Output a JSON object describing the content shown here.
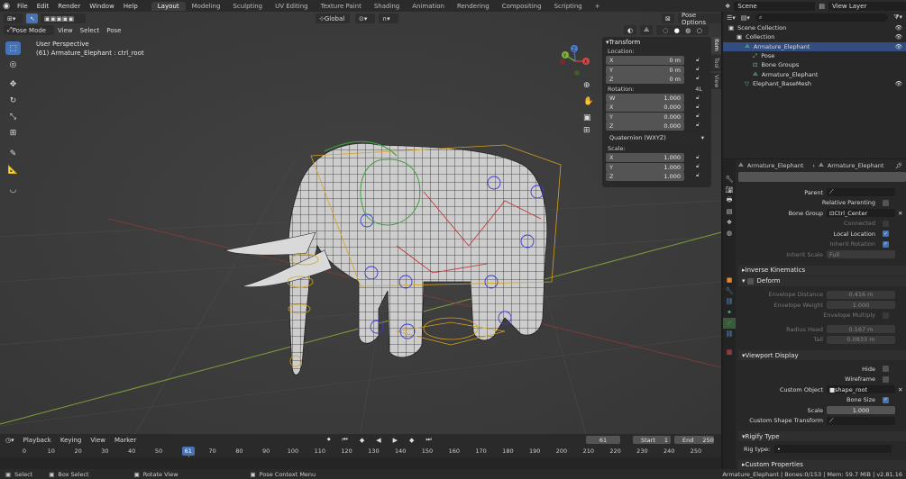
{
  "topbar": {
    "menus": [
      "File",
      "Edit",
      "Render",
      "Window",
      "Help"
    ],
    "workspaces": [
      "Layout",
      "Modeling",
      "Sculpting",
      "UV Editing",
      "Texture Paint",
      "Shading",
      "Animation",
      "Rendering",
      "Compositing",
      "Scripting"
    ],
    "active_workspace": "Layout",
    "add_workspace": "+",
    "scene": "Scene",
    "view_layer": "View Layer"
  },
  "viewport": {
    "mode": "Pose Mode",
    "menus": [
      "View",
      "Select",
      "Pose"
    ],
    "orientation": "Global",
    "pose_options": "Pose Options",
    "info_line1": "User Perspective",
    "info_line2": "(61) Armature_Elephant : ctrl_root",
    "gizmo": {
      "x": "X",
      "y": "Y",
      "z": "Z"
    }
  },
  "npanel": {
    "title": "Transform",
    "location_label": "Location:",
    "location": [
      {
        "k": "X",
        "v": "0 m"
      },
      {
        "k": "Y",
        "v": "0 m"
      },
      {
        "k": "Z",
        "v": "0 m"
      }
    ],
    "rotation_label": "Rotation:",
    "rotation_mode_badge": "4L",
    "rotation": [
      {
        "k": "W",
        "v": "1.000"
      },
      {
        "k": "X",
        "v": "0.000"
      },
      {
        "k": "Y",
        "v": "0.000"
      },
      {
        "k": "Z",
        "v": "0.000"
      }
    ],
    "rotation_mode": "Quaternion (WXYZ)",
    "scale_label": "Scale:",
    "scale": [
      {
        "k": "X",
        "v": "1.000"
      },
      {
        "k": "Y",
        "v": "1.000"
      },
      {
        "k": "Z",
        "v": "1.000"
      }
    ],
    "tabs": [
      "Item",
      "Tool",
      "View"
    ]
  },
  "timeline": {
    "menus": [
      "Playback",
      "Keying",
      "View",
      "Marker"
    ],
    "current_frame": "61",
    "start_label": "Start",
    "start": "1",
    "end_label": "End",
    "end": "250",
    "ticks": [
      "0",
      "10",
      "20",
      "30",
      "40",
      "50",
      "61",
      "70",
      "80",
      "90",
      "100",
      "110",
      "120",
      "130",
      "140",
      "150",
      "160",
      "170",
      "180",
      "190",
      "200",
      "210",
      "220",
      "230",
      "240",
      "250"
    ]
  },
  "statusbar": {
    "select": "Select",
    "box_select": "Box Select",
    "rotate_view": "Rotate View",
    "context_menu": "Pose Context Menu",
    "stats": "Armature_Elephant | Bones:0/153 | Mem: 59.7 MiB | v2.81.16"
  },
  "outliner": {
    "items": [
      {
        "label": "Scene Collection",
        "indent": 0
      },
      {
        "label": "Collection",
        "indent": 1
      },
      {
        "label": "Armature_Elephant",
        "indent": 2,
        "selected": true
      },
      {
        "label": "Pose",
        "indent": 3
      },
      {
        "label": "Bone Groups",
        "indent": 3
      },
      {
        "label": "Armature_Elephant",
        "indent": 3
      },
      {
        "label": "Elephant_BaseMesh",
        "indent": 2
      }
    ]
  },
  "properties": {
    "breadcrumb1": "Armature_Elephant",
    "breadcrumb2": "Armature_Elephant",
    "parent_label": "Parent",
    "relative_parenting": "Relative Parenting",
    "bone_group_label": "Bone Group",
    "bone_group": "Ctrl_Center",
    "connected": "Connected",
    "local_location": "Local Location",
    "inherit_rotation": "Inherit Rotation",
    "inherit_scale_label": "Inherit Scale",
    "inherit_scale": "Full",
    "inverse_kinematics": "Inverse Kinematics",
    "deform": "Deform",
    "envelope_distance_label": "Envelope Distance",
    "envelope_distance": "0.416 m",
    "envelope_weight_label": "Envelope Weight",
    "envelope_weight": "1.000",
    "envelope_multiply": "Envelope Multiply",
    "radius_head_label": "Radius Head",
    "radius_head": "0.167 m",
    "tail_label": "Tail",
    "tail": "0.0833 m",
    "viewport_display": "Viewport Display",
    "hide": "Hide",
    "wireframe": "Wireframe",
    "custom_object_label": "Custom Object",
    "custom_object": "shape_root",
    "bone_size": "Bone Size",
    "scale_label": "Scale",
    "scale": "1.000",
    "custom_shape_transform": "Custom Shape Transform",
    "rigify_type": "Rigify Type",
    "rig_type_label": "Rig type:",
    "custom_properties": "Custom Properties"
  }
}
